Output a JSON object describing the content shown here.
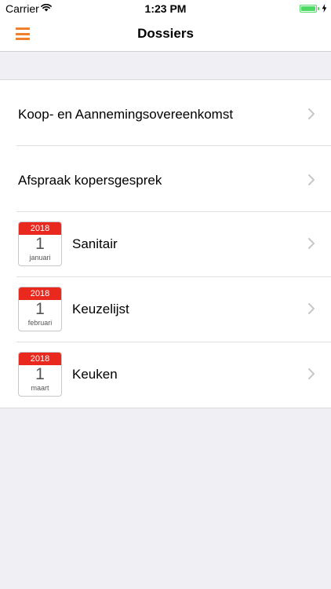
{
  "status_bar": {
    "carrier": "Carrier",
    "time": "1:23 PM",
    "battery_level": 1.0
  },
  "nav": {
    "title": "Dossiers",
    "menu_icon": "hamburger-icon",
    "accent_color": "#f0802b"
  },
  "items": [
    {
      "label": "Koop- en Aannemingsovereenkomst"
    },
    {
      "label": "Afspraak kopersgesprek"
    },
    {
      "label": "Sanitair",
      "date": {
        "year": "2018",
        "day": "1",
        "month": "januari"
      }
    },
    {
      "label": "Keuzelijst",
      "date": {
        "year": "2018",
        "day": "1",
        "month": "februari"
      }
    },
    {
      "label": "Keuken",
      "date": {
        "year": "2018",
        "day": "1",
        "month": "maart"
      }
    }
  ],
  "colors": {
    "calendar_header": "#e9291e",
    "battery": "#4cd964",
    "background": "#efeff4"
  }
}
